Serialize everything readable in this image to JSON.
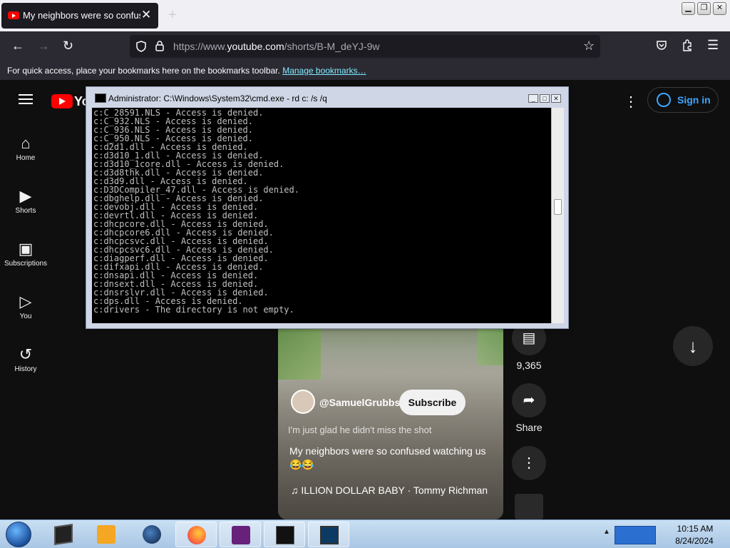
{
  "browser": {
    "tab_title": "My neighbors were so confused watching us",
    "tab_close": "✕",
    "new_tab": "+",
    "url_prefix": "https://www.",
    "url_host": "youtube.com",
    "url_path": "/shorts/B-M_deYJ-9w",
    "bookmarks_text": "For quick access, place your bookmarks here on the bookmarks toolbar.",
    "bookmarks_link": "Manage bookmarks…",
    "window_controls": {
      "minimize": "▁",
      "maximize": "❐",
      "close": "✕"
    }
  },
  "youtube": {
    "logo_text": "Yo",
    "sidebar": [
      {
        "label": "Home",
        "icon": "⌂"
      },
      {
        "label": "Shorts",
        "icon": "▶"
      },
      {
        "label": "Subscriptions",
        "icon": "▣"
      },
      {
        "label": "You",
        "icon": "▷"
      },
      {
        "label": "History",
        "icon": "↺"
      }
    ],
    "more": "⋮",
    "sign_in": "Sign in",
    "short": {
      "channel": "@SamuelGrubbs",
      "subscribe": "Subscribe",
      "caption": "I'm just glad he didn't miss the shot",
      "description": "My neighbors were so confused watching us 😂😂",
      "music": "♫ ILLION DOLLAR BABY · Tommy Richman"
    },
    "actions": {
      "comments_count": "9,365",
      "share_label": "Share",
      "more": "⋮"
    },
    "scroll_down": "↓"
  },
  "cmd": {
    "title": "Administrator: C:\\Windows\\System32\\cmd.exe - rd  c: /s /q",
    "lines": [
      "c:C_28591.NLS - Access is denied.",
      "c:C_932.NLS - Access is denied.",
      "c:C_936.NLS - Access is denied.",
      "c:C_950.NLS - Access is denied.",
      "c:d2d1.dll - Access is denied.",
      "c:d3d10_1.dll - Access is denied.",
      "c:d3d10_1core.dll - Access is denied.",
      "c:d3d8thk.dll - Access is denied.",
      "c:d3d9.dll - Access is denied.",
      "c:D3DCompiler_47.dll - Access is denied.",
      "c:dbghelp.dll - Access is denied.",
      "c:devobj.dll - Access is denied.",
      "c:devrtl.dll - Access is denied.",
      "c:dhcpcore.dll - Access is denied.",
      "c:dhcpcore6.dll - Access is denied.",
      "c:dhcpcsvc.dll - Access is denied.",
      "c:dhcpcsvc6.dll - Access is denied.",
      "c:diagperf.dll - Access is denied.",
      "c:difxapi.dll - Access is denied.",
      "c:dnsapi.dll - Access is denied.",
      "c:dnsext.dll - Access is denied.",
      "c:dnsrslvr.dll - Access is denied.",
      "c:dps.dll - Access is denied.",
      "c:drivers - The directory is not empty."
    ]
  },
  "taskbar": {
    "time": "10:15 AM",
    "date": "8/24/2024",
    "tray_expand": "▲"
  }
}
